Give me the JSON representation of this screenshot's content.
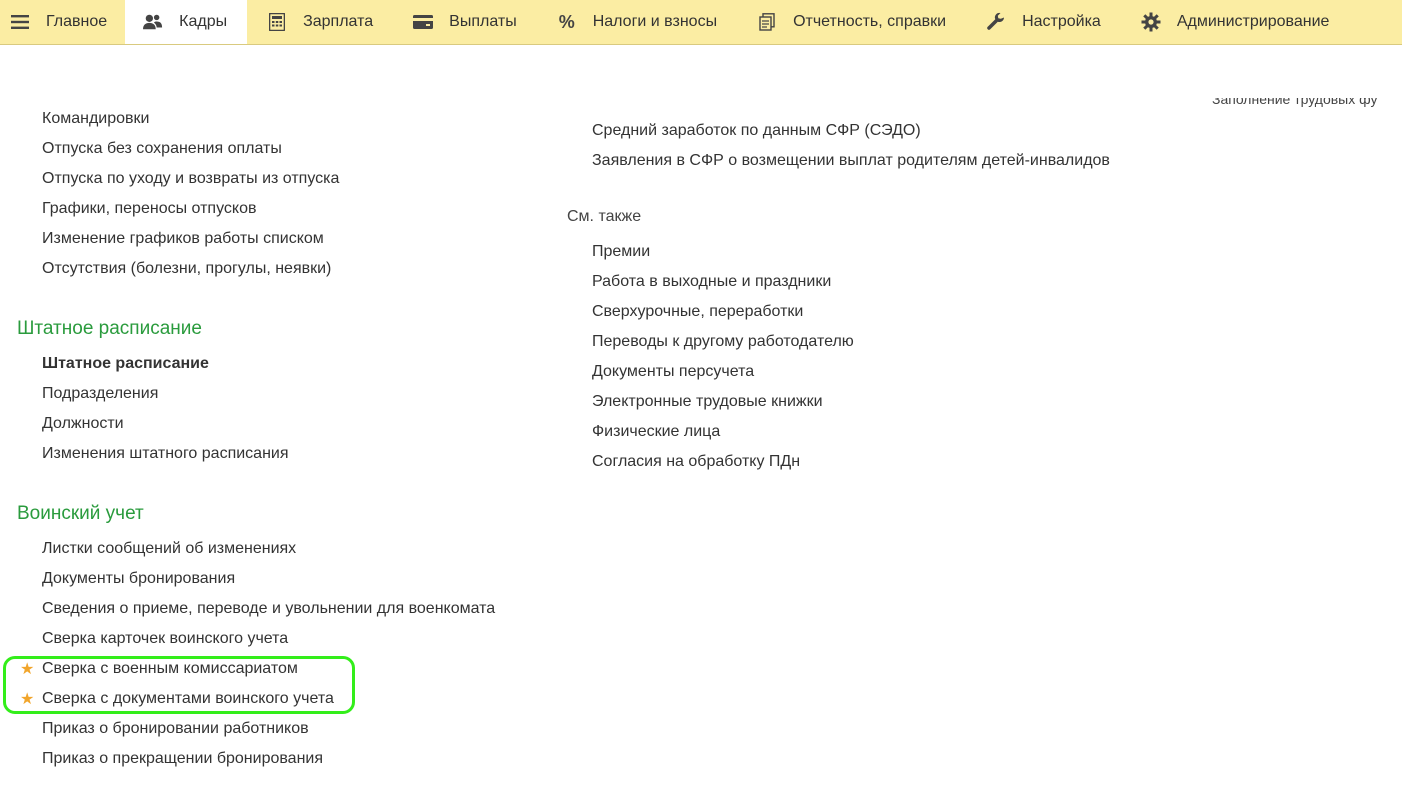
{
  "nav": {
    "tabs": [
      {
        "label": "Главное",
        "icon": "menu-icon"
      },
      {
        "label": "Кадры",
        "icon": "people-icon",
        "active": true
      },
      {
        "label": "Зарплата",
        "icon": "calculator-icon"
      },
      {
        "label": "Выплаты",
        "icon": "wallet-icon"
      },
      {
        "label": "Налоги и взносы",
        "icon": "percent-icon"
      },
      {
        "label": "Отчетность, справки",
        "icon": "documents-icon"
      },
      {
        "label": "Настройка",
        "icon": "wrench-icon"
      },
      {
        "label": "Администрирование",
        "icon": "gear-icon"
      }
    ],
    "active_color": "#ffffff",
    "bar_color": "#fbeda3"
  },
  "clipped_text": "Заполнение трудовых фу",
  "left": {
    "top_links": [
      "Командировки",
      "Отпуска без сохранения оплаты",
      "Отпуска по уходу и возвраты из отпуска",
      "Графики, переносы отпусков",
      "Изменение графиков работы списком",
      "Отсутствия (болезни, прогулы, неявки)"
    ],
    "staffing": {
      "title": "Штатное расписание",
      "links": [
        "Штатное расписание",
        "Подразделения",
        "Должности",
        "Изменения штатного расписания"
      ]
    },
    "military": {
      "title": "Воинский учет",
      "links": [
        "Листки сообщений об изменениях",
        "Документы бронирования",
        "Сведения о приеме, переводе и увольнении для военкомата",
        "Сверка карточек воинского учета",
        "Сверка с военным комиссариатом",
        "Сверка с документами воинского учета",
        "Приказ о бронировании работников",
        "Приказ о прекращении бронирования"
      ]
    }
  },
  "right": {
    "top_links": [
      "Средний заработок по данным СФР (СЭДО)",
      "Заявления в СФР о возмещении выплат родителям детей-инвалидов"
    ],
    "see_also": {
      "title": "См. также",
      "links": [
        "Премии",
        "Работа в выходные и праздники",
        "Сверхурочные, переработки",
        "Переводы к другому работодателю",
        "Документы персучета",
        "Электронные трудовые книжки",
        "Физические лица",
        "Согласия на обработку ПДн"
      ]
    }
  },
  "colors": {
    "section_title": "#2a9b3d",
    "star": "#f1a52b",
    "highlight": "#33ee1a"
  }
}
